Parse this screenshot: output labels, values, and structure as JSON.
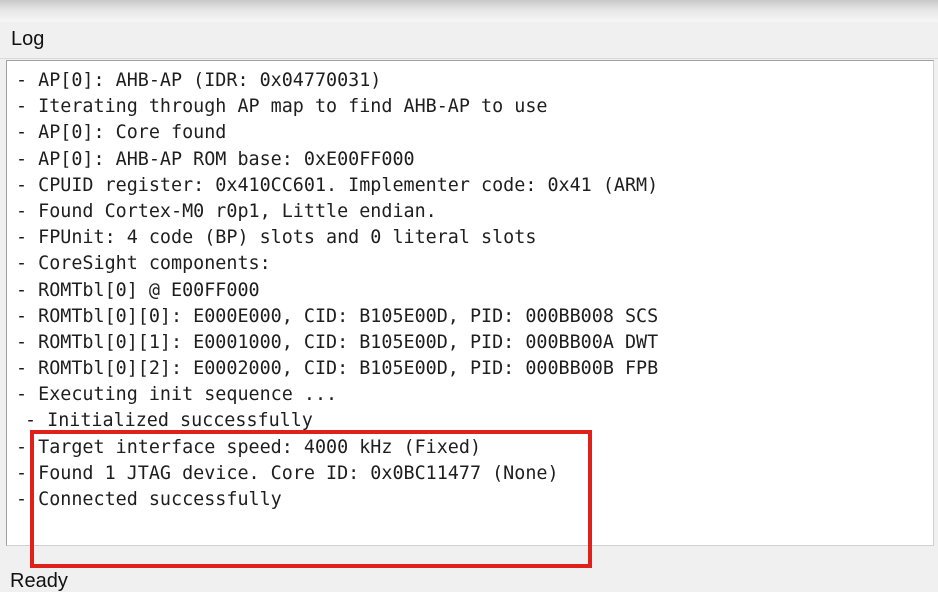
{
  "window": {
    "title": "Log"
  },
  "log": {
    "lines": [
      "- AP[0]: AHB-AP (IDR: 0x04770031)",
      "- Iterating through AP map to find AHB-AP to use",
      "- AP[0]: Core found",
      "- AP[0]: AHB-AP ROM base: 0xE00FF000",
      "- CPUID register: 0x410CC601. Implementer code: 0x41 (ARM)",
      "- Found Cortex-M0 r0p1, Little endian.",
      "- FPUnit: 4 code (BP) slots and 0 literal slots",
      "- CoreSight components:",
      "- ROMTbl[0] @ E00FF000",
      "- ROMTbl[0][0]: E000E000, CID: B105E00D, PID: 000BB008 SCS",
      "- ROMTbl[0][1]: E0001000, CID: B105E00D, PID: 000BB00A DWT",
      "- ROMTbl[0][2]: E0002000, CID: B105E00D, PID: 000BB00B FPB",
      "- Executing init sequence ...",
      "- Initialized successfully",
      "- Target interface speed: 4000 kHz (Fixed)",
      "- Found 1 JTAG device. Core ID: 0x0BC11477 (None)",
      "- Connected successfully"
    ]
  },
  "status_bar": {
    "text": "Ready"
  },
  "colors": {
    "highlight_border": "#e0201a",
    "window_background": "#f0f0f0",
    "log_background": "#ffffff"
  }
}
